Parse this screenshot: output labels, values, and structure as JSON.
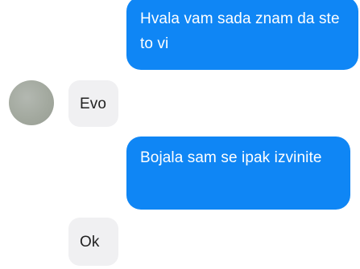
{
  "conversation": {
    "messages": [
      {
        "sender": "me",
        "text": "Hvala vam sada znam da ste to vi"
      },
      {
        "sender": "contact",
        "text": "Evo"
      },
      {
        "sender": "me",
        "text": "Bojala sam se ipak izvinite"
      },
      {
        "sender": "contact",
        "text": "Ok"
      }
    ]
  },
  "colors": {
    "outgoing_bubble": "#0f86f5",
    "incoming_bubble": "#f0f0f2",
    "outgoing_text": "#ffffff",
    "incoming_text": "#222222",
    "avatar": "#a3a99f"
  }
}
